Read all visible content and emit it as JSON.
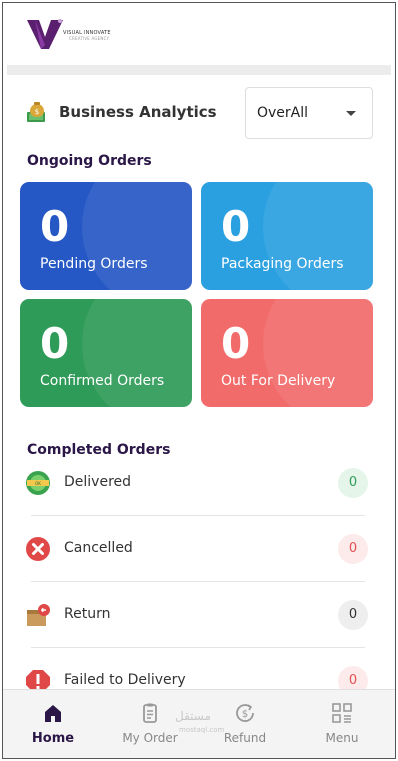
{
  "brand": {
    "name": "VISUAL INNOVATE",
    "tagline": "CREATIVE AGENCY"
  },
  "analytics": {
    "title": "Business Analytics",
    "filter_value": "OverAll"
  },
  "ongoing": {
    "title": "Ongoing Orders",
    "cards": [
      {
        "count": "0",
        "label": "Pending Orders",
        "color": "#2557c5"
      },
      {
        "count": "0",
        "label": "Packaging Orders",
        "color": "#2aa0e0"
      },
      {
        "count": "0",
        "label": "Confirmed Orders",
        "color": "#2f9b58"
      },
      {
        "count": "0",
        "label": "Out For Delivery",
        "color": "#f26b6b"
      }
    ]
  },
  "completed": {
    "title": "Completed Orders",
    "items": [
      {
        "label": "Delivered",
        "count": "0",
        "count_color": "#2f9b58",
        "count_bg": "#e5f5ea"
      },
      {
        "label": "Cancelled",
        "count": "0",
        "count_color": "#e05252",
        "count_bg": "#fdeaea"
      },
      {
        "label": "Return",
        "count": "0",
        "count_color": "#333333",
        "count_bg": "#eeeeee"
      },
      {
        "label": "Failed to Delivery",
        "count": "0",
        "count_color": "#e05252",
        "count_bg": "#fdeaea"
      }
    ]
  },
  "nav": {
    "items": [
      {
        "label": "Home",
        "icon": "home-icon",
        "active": true
      },
      {
        "label": "My Order",
        "icon": "clipboard-icon",
        "active": false
      },
      {
        "label": "Refund",
        "icon": "refund-icon",
        "active": false
      },
      {
        "label": "Menu",
        "icon": "menu-grid-icon",
        "active": false
      }
    ]
  },
  "watermark": {
    "text": "مستقل",
    "sub": "mostaql.com"
  }
}
